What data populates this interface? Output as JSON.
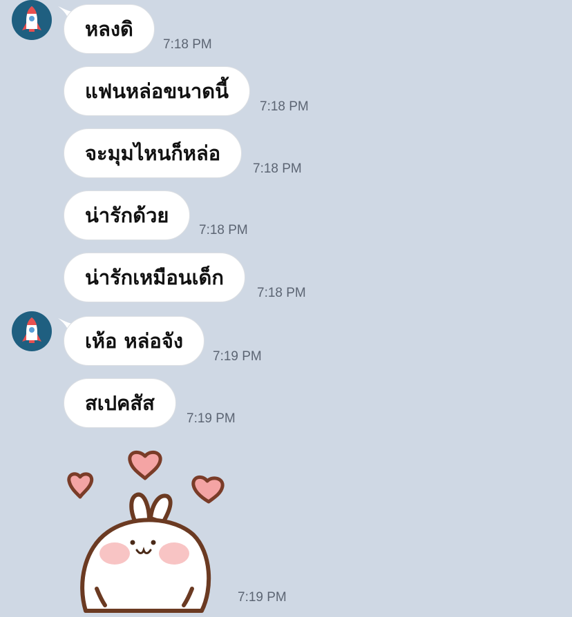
{
  "chat": {
    "messages": [
      {
        "text": "หลงดิ",
        "time": "7:18 PM"
      },
      {
        "text": "แฟนหล่อขนาดนี้",
        "time": "7:18 PM"
      },
      {
        "text": "จะมุมไหนก็หล่อ",
        "time": "7:18 PM"
      },
      {
        "text": "น่ารักด้วย",
        "time": "7:18 PM"
      },
      {
        "text": "น่ารักเหมือนเด็ก",
        "time": "7:18 PM"
      },
      {
        "text": "เห้อ หล่อจัง",
        "time": "7:19 PM"
      },
      {
        "text": "สเปคสัส",
        "time": "7:19 PM"
      }
    ],
    "sticker": {
      "icon": "bunny-with-hearts-sticker",
      "time": "7:19 PM"
    },
    "avatar_icon": "rocket-icon"
  },
  "colors": {
    "background": "#cfd8e4",
    "bubble": "#ffffff",
    "timestamp": "#5c6573",
    "avatar_background": "#1f5f80"
  }
}
